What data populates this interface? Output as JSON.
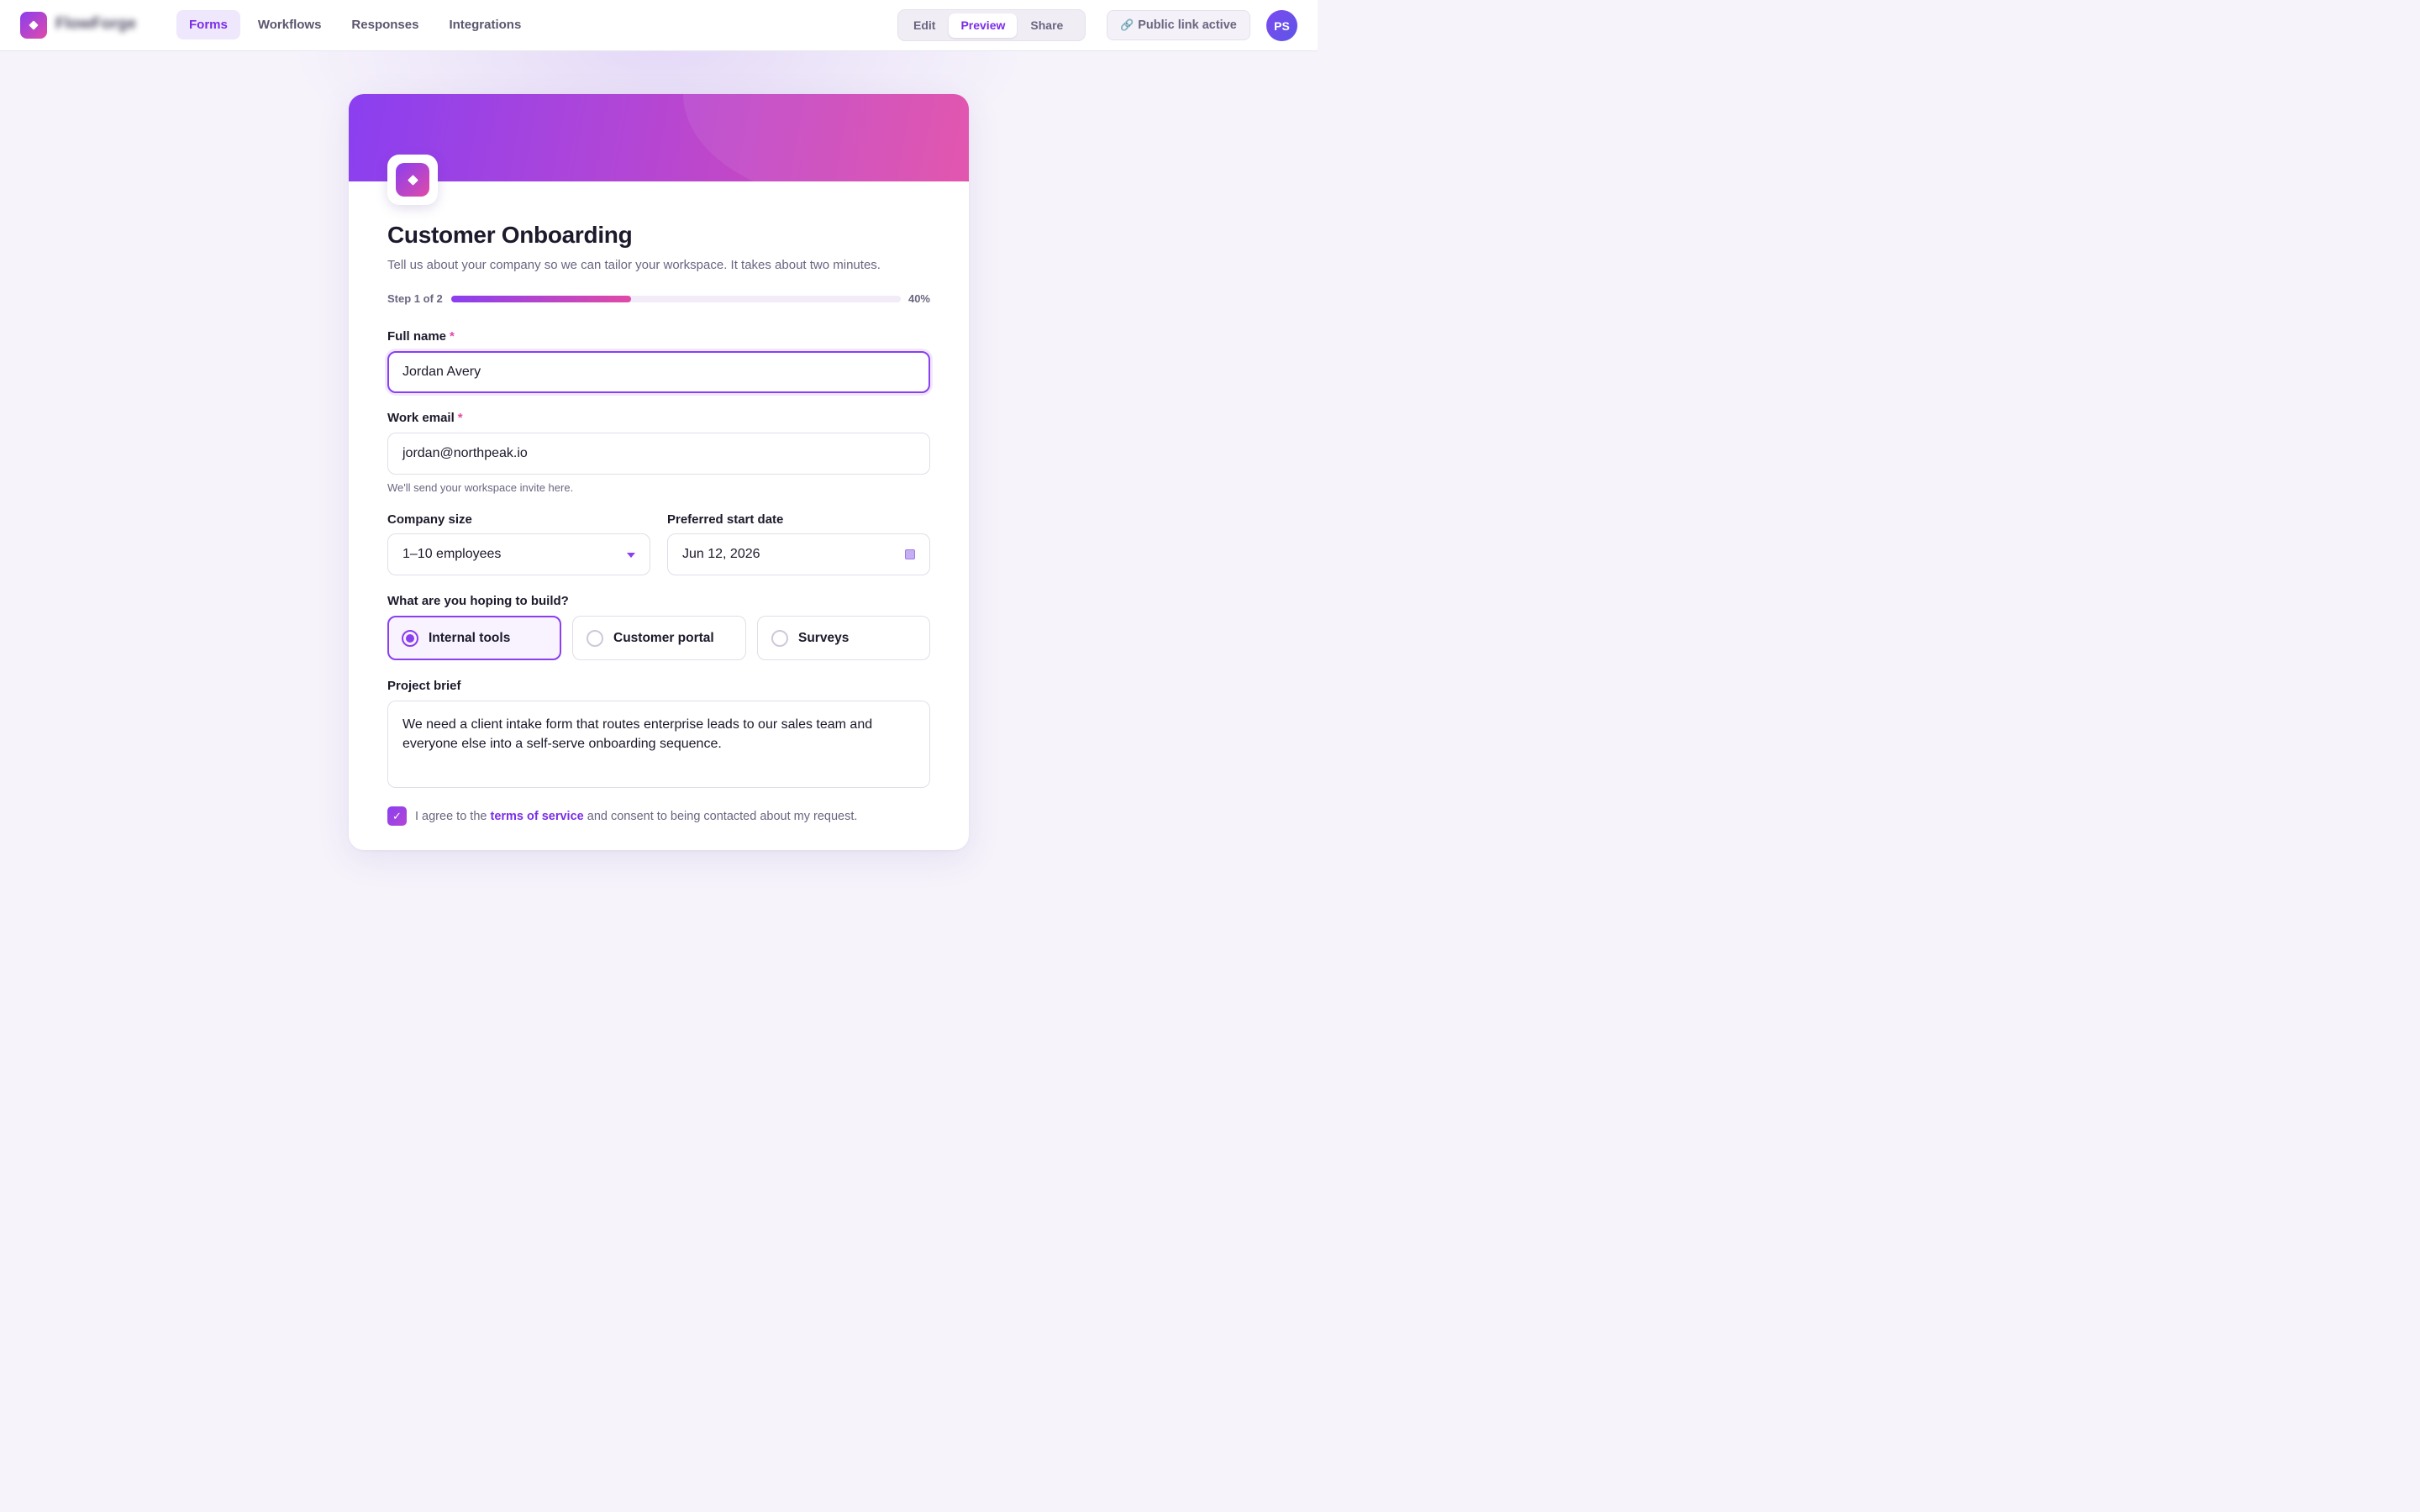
{
  "app": {
    "brand": "FlowForge"
  },
  "nav": {
    "items": [
      {
        "label": "Forms",
        "active": true
      },
      {
        "label": "Workflows",
        "active": false
      },
      {
        "label": "Responses",
        "active": false
      },
      {
        "label": "Integrations",
        "active": false
      }
    ]
  },
  "mode": {
    "options": [
      "Edit",
      "Preview",
      "Share"
    ],
    "selected": "Preview"
  },
  "public_link": {
    "icon": "link-icon",
    "label": "Public link active"
  },
  "user": {
    "initials": "PS"
  },
  "form": {
    "title": "Customer Onboarding",
    "subtitle": "Tell us about your company so we can tailor your workspace. It takes about two minutes.",
    "progress": {
      "step_label": "Step 1 of 2",
      "percent_label": "40%",
      "fraction": 0.4
    },
    "full_name": {
      "label": "Full name",
      "required_mark": "*",
      "value": "Jordan Avery"
    },
    "work_email": {
      "label": "Work email",
      "required_mark": "*",
      "value": "jordan@northpeak.io",
      "helper": "We'll send your workspace invite here."
    },
    "company_size": {
      "label": "Company size",
      "value": "1–10 employees"
    },
    "start_date": {
      "label": "Preferred start date",
      "value": "Jun 12, 2026"
    },
    "build_goal": {
      "label": "What are you hoping to build?",
      "options": [
        {
          "label": "Internal tools",
          "selected": true
        },
        {
          "label": "Customer portal",
          "selected": false
        },
        {
          "label": "Surveys",
          "selected": false
        }
      ]
    },
    "brief": {
      "label": "Project brief",
      "value": "We need a client intake form that routes enterprise leads to our sales team and everyone else into a self-serve onboarding sequence."
    },
    "consent": {
      "checked": true,
      "prefix": "I agree to the",
      "link": "terms of service",
      "suffix": "and consent to being contacted about my request."
    }
  },
  "colors": {
    "accent": "#8a3ff0",
    "accent_pink": "#e04aa8",
    "text": "#1c1a2b",
    "muted": "#6b6580"
  }
}
